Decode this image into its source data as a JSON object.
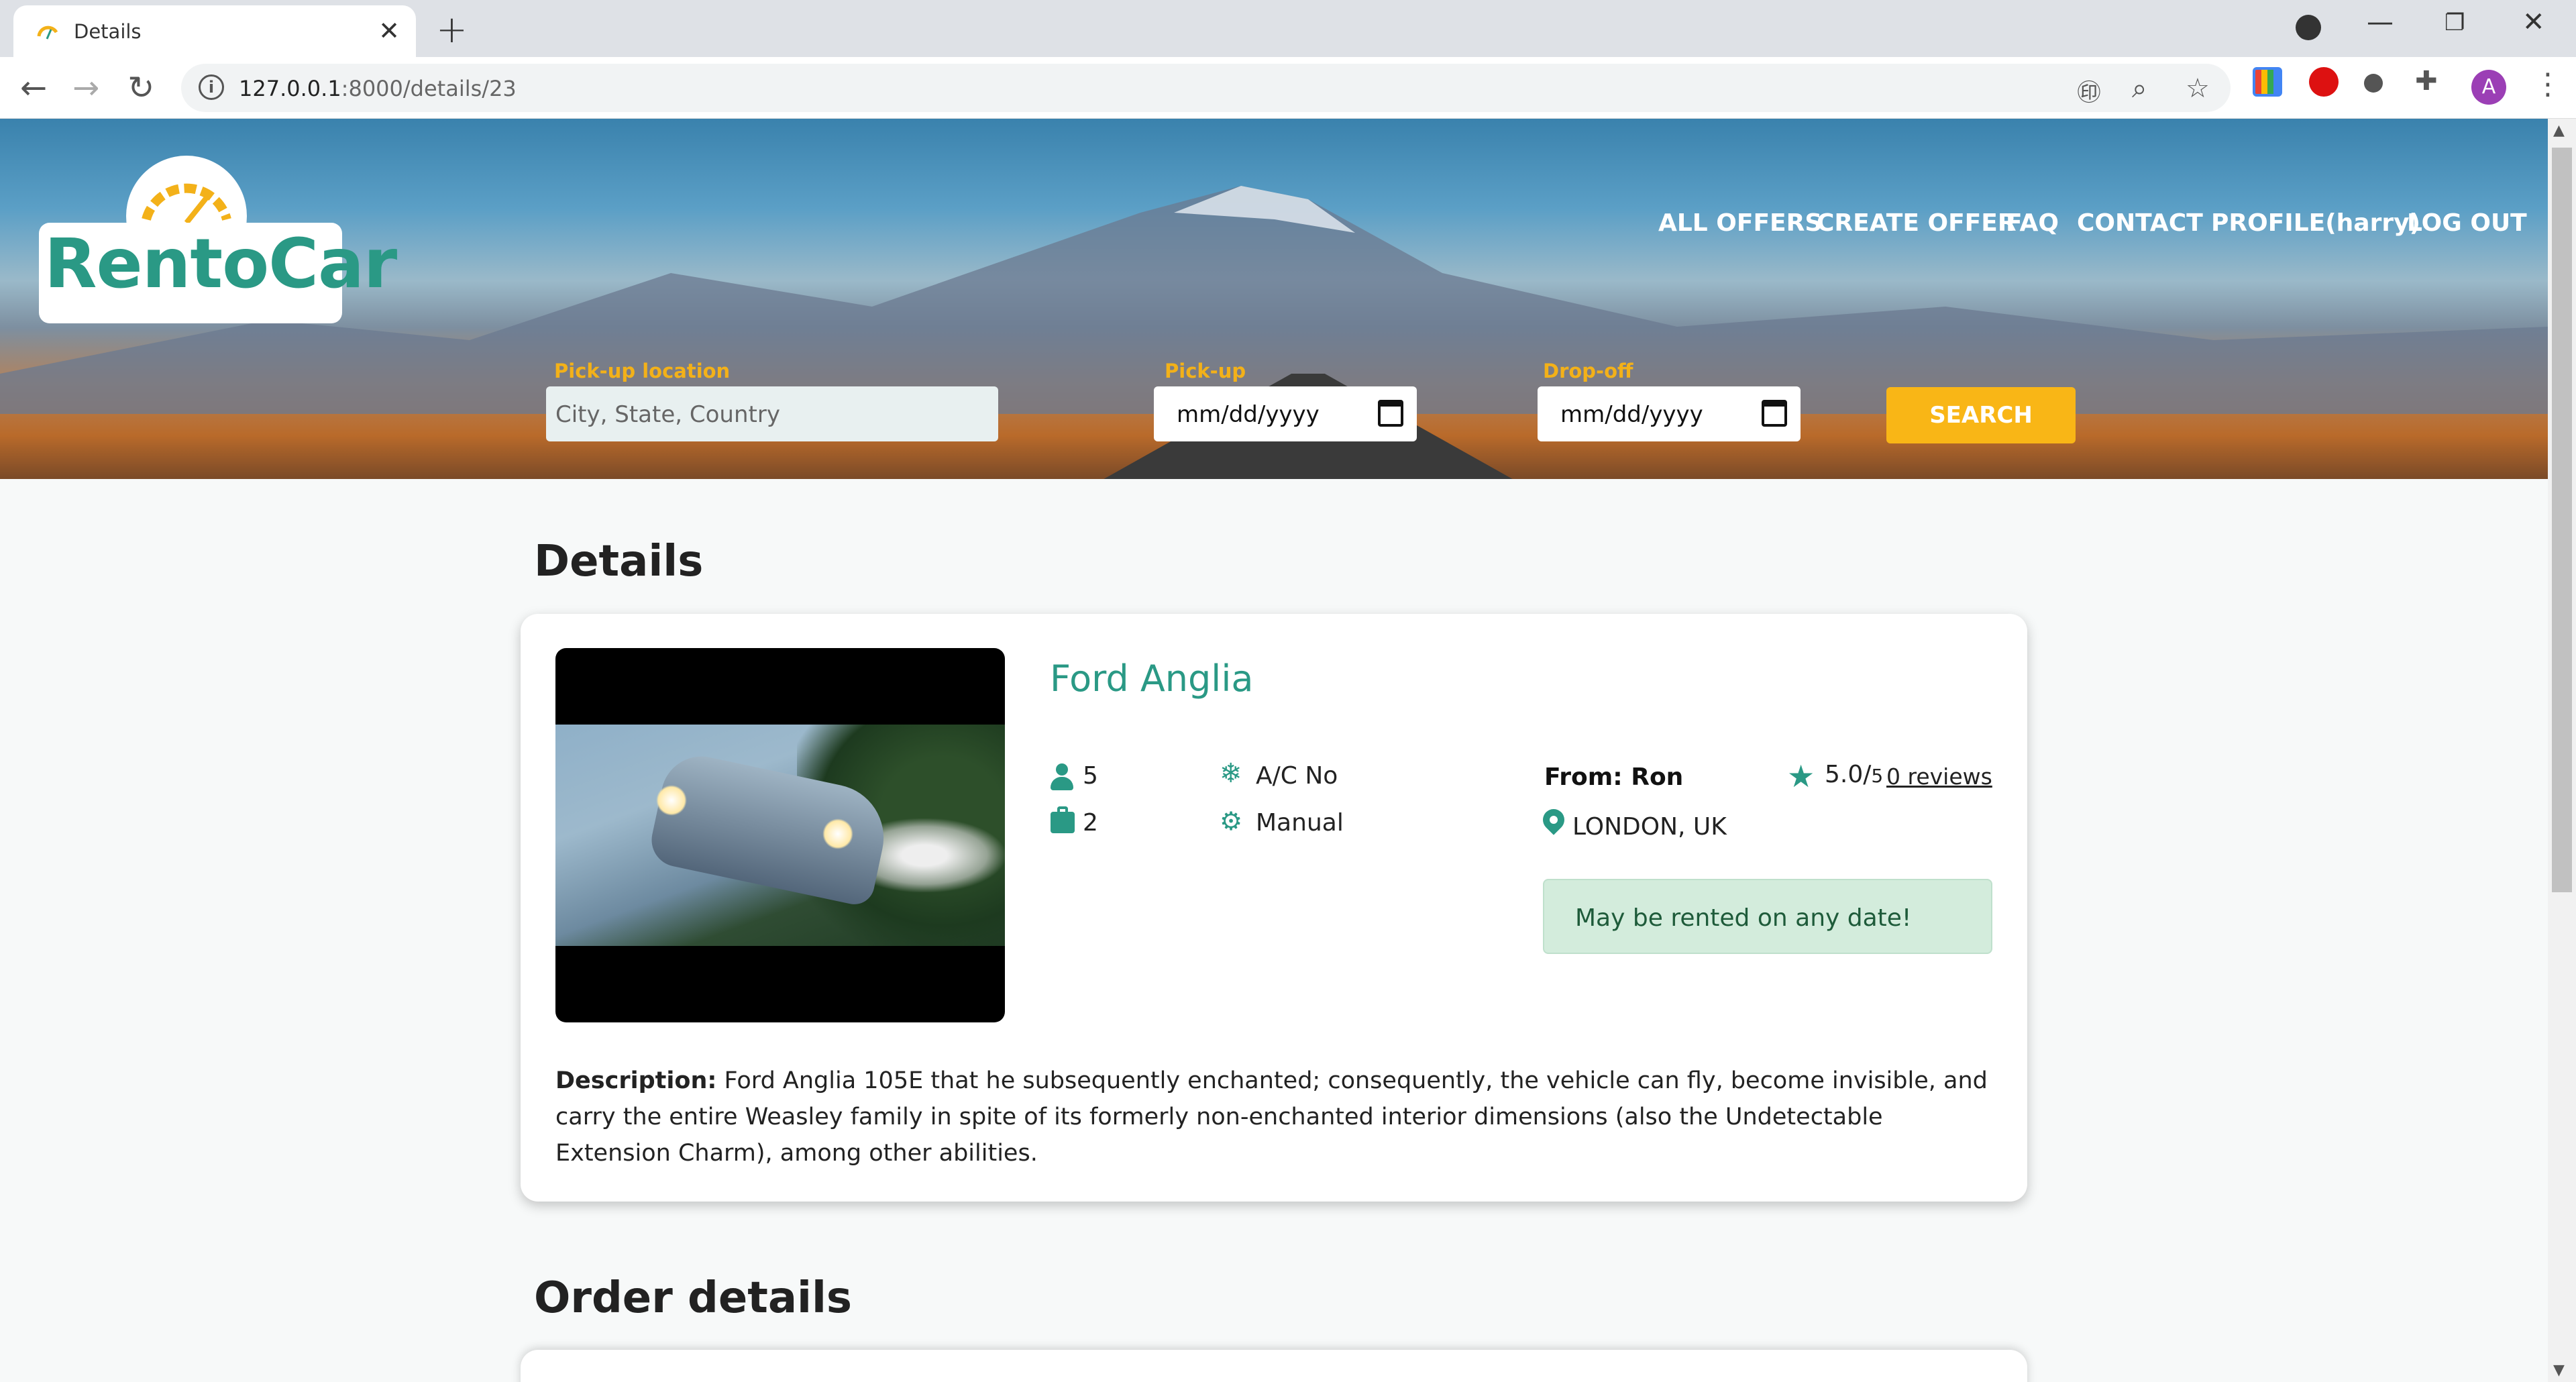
{
  "browser": {
    "tab_title": "Details",
    "url_host": "127.0.0.1",
    "url_rest": ":8000/details/23",
    "icons": [
      "translate-icon",
      "zoom-icon",
      "star-bookmark-icon",
      "extension-icon",
      "profile-avatar"
    ],
    "avatar_letter": "A"
  },
  "site": {
    "logo": "RentoCar",
    "nav": [
      "ALL OFFERS",
      "CREATE OFFER",
      "FAQ",
      "CONTACT",
      "PROFILE(harry)",
      "LOG OUT"
    ],
    "search": {
      "location_label": "Pick-up location",
      "location_placeholder": "City, State, Country",
      "pickup_label": "Pick-up",
      "pickup_value": "mm/dd/yyyy",
      "dropoff_label": "Drop-off",
      "dropoff_value": "mm/dd/yyyy",
      "button": "SEARCH"
    }
  },
  "details": {
    "heading": "Details",
    "car_name": "Ford Anglia",
    "seats": "5",
    "bags": "2",
    "ac": "A/C No",
    "transmission": "Manual",
    "owner": "From: Ron",
    "rating": "5.0/",
    "rating_max": "5",
    "reviews": "0 reviews",
    "location": "LONDON, UK",
    "availability": "May be rented on any date!",
    "description_label": "Description:",
    "description_text": " Ford Anglia 105E that he subsequently enchanted; consequently, the vehicle can fly, become invisible, and carry the entire Weasley family in spite of its formerly non-enchanted interior dimensions (also the Undetectable Extension Charm), among other abilities."
  },
  "order": {
    "heading": "Order details"
  },
  "colors": {
    "accent": "#2a9985",
    "search_button": "#f9b616",
    "label": "#f3b119"
  }
}
